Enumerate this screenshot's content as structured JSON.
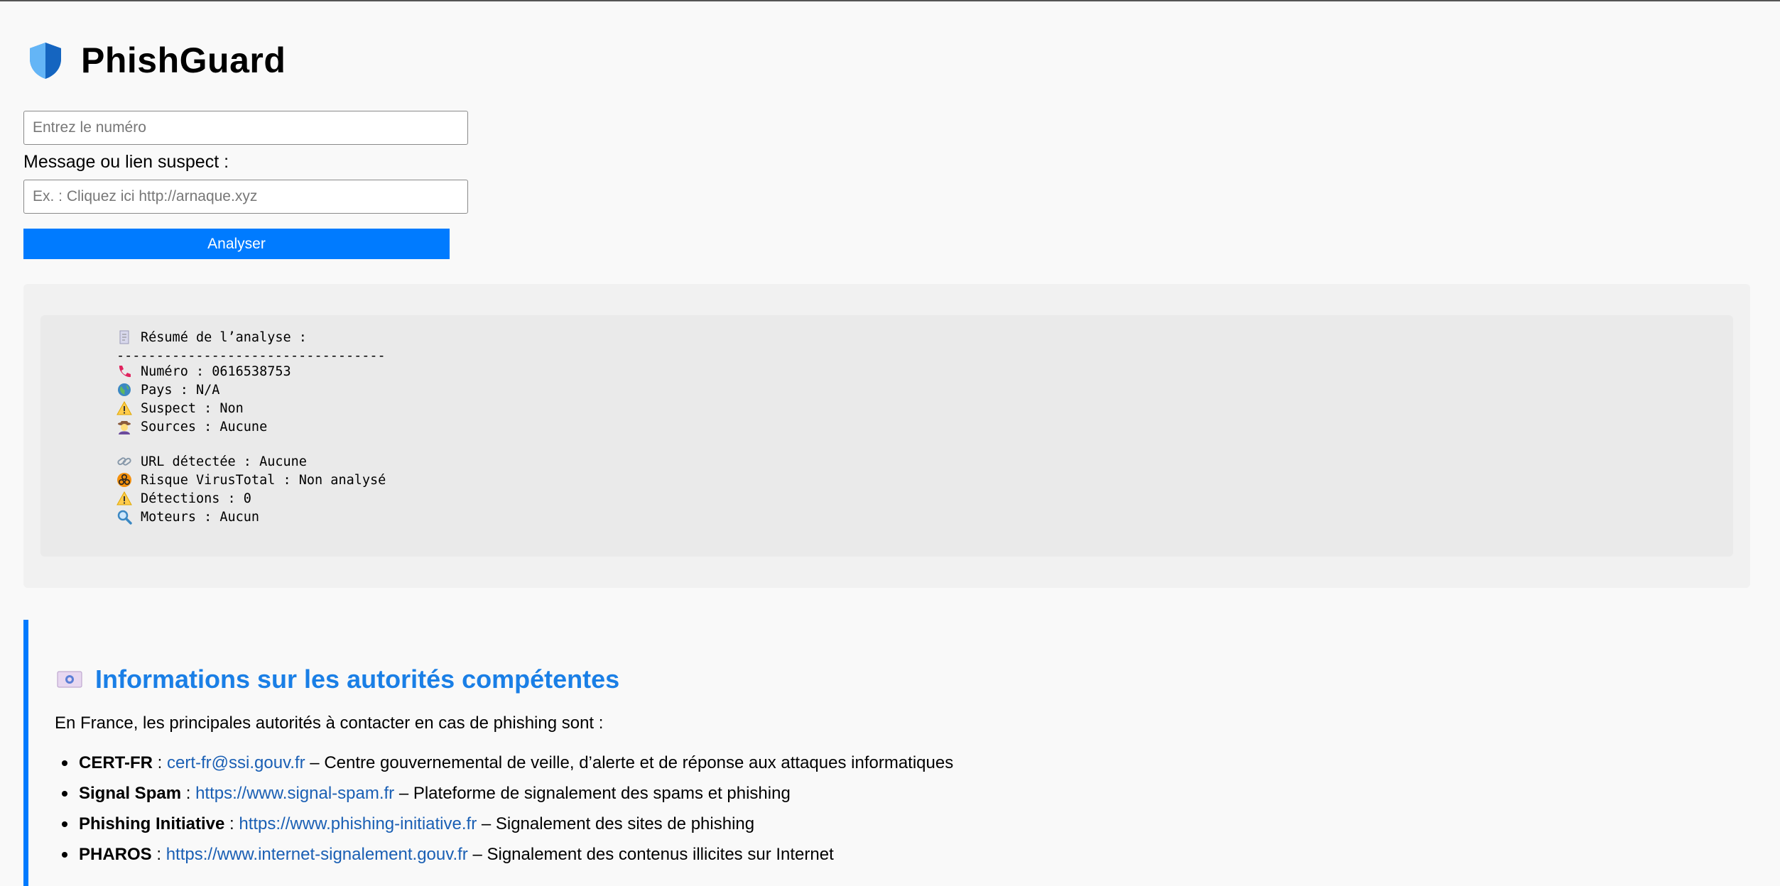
{
  "app": {
    "title": "PhishGuard",
    "logo_icon": "shield-icon"
  },
  "form": {
    "phone_placeholder": "Entrez le numéro",
    "phone_value": "",
    "message_label": "Message ou lien suspect :",
    "message_placeholder": "Ex. : Cliquez ici http://arnaque.xyz",
    "message_value": "",
    "analyze_label": "Analyser",
    "accent_color": "#007bff"
  },
  "result": {
    "heading": "Résumé de l’analyse :",
    "separator": "----------------------------------",
    "phone_lines": [
      {
        "icon": "phone-icon",
        "text": "Numéro : 0616538753"
      },
      {
        "icon": "globe-icon",
        "text": "Pays : N/A"
      },
      {
        "icon": "warning-icon",
        "text": "Suspect : Non"
      },
      {
        "icon": "detective-icon",
        "text": "Sources : Aucune"
      }
    ],
    "url_lines": [
      {
        "icon": "link-icon",
        "text": "URL détectée : Aucune"
      },
      {
        "icon": "biohazard-icon",
        "text": "Risque VirusTotal : Non analysé"
      },
      {
        "icon": "warning-icon",
        "text": "Détections : 0"
      },
      {
        "icon": "magnifier-icon",
        "text": "Moteurs : Aucun"
      }
    ]
  },
  "authorities": {
    "title": "Informations sur les autorités compétentes",
    "intro": "En France, les principales autorités à contacter en cas de phishing sont :",
    "items": [
      {
        "name": "CERT-FR",
        "sep": " : ",
        "link": "cert-fr@ssi.gouv.fr",
        "desc": " – Centre gouvernemental de veille, d’alerte et de réponse aux attaques informatiques"
      },
      {
        "name": "Signal Spam",
        "sep": " : ",
        "link": "https://www.signal-spam.fr",
        "desc": " – Plateforme de signalement des spams et phishing"
      },
      {
        "name": "Phishing Initiative",
        "sep": " : ",
        "link": "https://www.phishing-initiative.fr",
        "desc": " – Signalement des sites de phishing"
      },
      {
        "name": "PHAROS",
        "sep": " : ",
        "link": "https://www.internet-signalement.gouv.fr",
        "desc": " – Signalement des contenus illicites sur Internet"
      }
    ]
  }
}
